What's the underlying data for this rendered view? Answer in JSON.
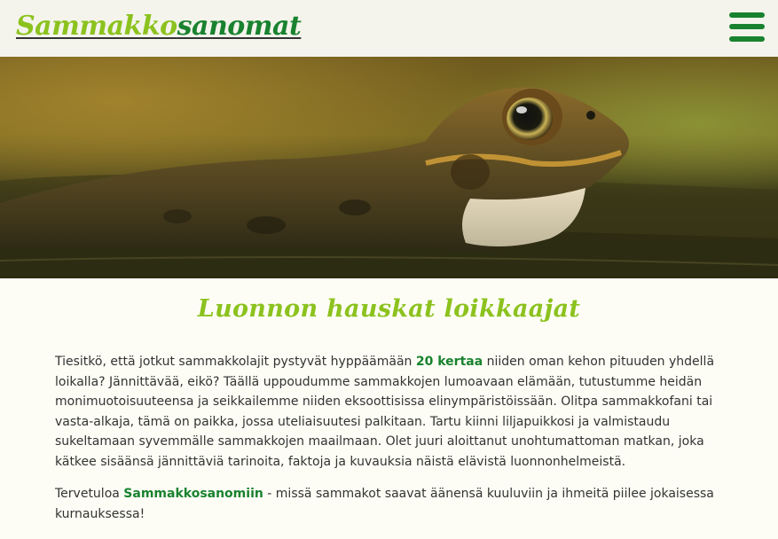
{
  "header": {
    "logo_part1": "Sammakko",
    "logo_part2": "sanomat",
    "menu_icon": "hamburger-menu-icon"
  },
  "hero": {
    "image": "frog-in-water-photo"
  },
  "main": {
    "title": "Luonnon hauskat loikkaajat",
    "p1_before": "Tiesitkö, että jotkut sammakkolajit pystyvät hyppäämään ",
    "p1_highlight": "20 kertaa",
    "p1_after": " niiden oman kehon pituuden yhdellä loikalla? Jännittävää, eikö? Täällä uppoudumme sammakkojen lumoavaan elämään, tutustumme heidän monimuotoisuuteensa ja seikkailemme niiden eksoottisissa elinympäristöissään. Olitpa sammakkofani tai vasta-alkaja, tämä on paikka, jossa uteliaisuutesi palkitaan. Tartu kiinni liljapuikkosi ja valmistaudu sukeltamaan syvemmälle sammakkojen maailmaan. Olet juuri aloittanut unohtumattoman matkan, joka kätkee sisäänsä jännittäviä tarinoita, faktoja ja kuvauksia näistä elävistä luonnonhelmeistä.",
    "p2_before": "Tervetuloa ",
    "p2_highlight": "Sammakkosanomiin",
    "p2_after": " - missä sammakot saavat äänensä kuuluviin ja ihmeitä piilee jokaisessa kurnauksessa!"
  },
  "colors": {
    "light_green": "#8cc21e",
    "dark_green": "#19822f",
    "header_bg": "#f4f4ec",
    "page_bg": "#fdfdf5"
  }
}
